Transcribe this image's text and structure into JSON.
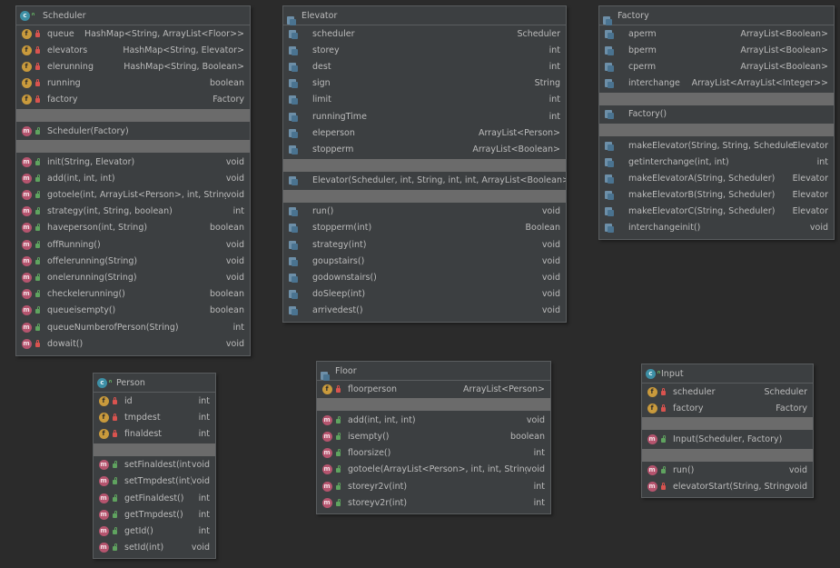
{
  "classes": {
    "scheduler": {
      "title": "Scheduler",
      "fields": [
        {
          "name": "queue",
          "type": "HashMap<String, ArrayList<Floor>>"
        },
        {
          "name": "elevators",
          "type": "HashMap<String, Elevator>"
        },
        {
          "name": "elerunning",
          "type": "HashMap<String, Boolean>"
        },
        {
          "name": "running",
          "type": "boolean"
        },
        {
          "name": "factory",
          "type": "Factory"
        }
      ],
      "constructors": [
        {
          "name": "Scheduler(Factory)"
        }
      ],
      "methods": [
        {
          "name": "init(String, Elevator)",
          "type": "void"
        },
        {
          "name": "add(int, int, int)",
          "type": "void"
        },
        {
          "name": "gotoele(int, ArrayList<Person>, int, String)",
          "type": "void"
        },
        {
          "name": "strategy(int, String, boolean)",
          "type": "int"
        },
        {
          "name": "haveperson(int, String)",
          "type": "boolean"
        },
        {
          "name": "offRunning()",
          "type": "void"
        },
        {
          "name": "offelerunning(String)",
          "type": "void"
        },
        {
          "name": "onelerunning(String)",
          "type": "void"
        },
        {
          "name": "checkelerunning()",
          "type": "boolean"
        },
        {
          "name": "queueisempty()",
          "type": "boolean"
        },
        {
          "name": "queueNumberofPerson(String)",
          "type": "int"
        },
        {
          "name": "dowait()",
          "type": "void"
        }
      ]
    },
    "elevator": {
      "title": "Elevator",
      "fields": [
        {
          "name": "scheduler",
          "type": "Scheduler"
        },
        {
          "name": "storey",
          "type": "int"
        },
        {
          "name": "dest",
          "type": "int"
        },
        {
          "name": "sign",
          "type": "String"
        },
        {
          "name": "limit",
          "type": "int"
        },
        {
          "name": "runningTime",
          "type": "int"
        },
        {
          "name": "eleperson",
          "type": "ArrayList<Person>"
        },
        {
          "name": "stopperm",
          "type": "ArrayList<Boolean>"
        }
      ],
      "constructors": [
        {
          "name": "Elevator(Scheduler, int, String, int, int, ArrayList<Boolean>)"
        }
      ],
      "methods": [
        {
          "name": "run()",
          "type": "void"
        },
        {
          "name": "stopperm(int)",
          "type": "Boolean"
        },
        {
          "name": "strategy(int)",
          "type": "void"
        },
        {
          "name": "goupstairs()",
          "type": "void"
        },
        {
          "name": "godownstairs()",
          "type": "void"
        },
        {
          "name": "doSleep(int)",
          "type": "void"
        },
        {
          "name": "arrivedest()",
          "type": "void"
        }
      ]
    },
    "factory": {
      "title": "Factory",
      "fields": [
        {
          "name": "aperm",
          "type": "ArrayList<Boolean>"
        },
        {
          "name": "bperm",
          "type": "ArrayList<Boolean>"
        },
        {
          "name": "cperm",
          "type": "ArrayList<Boolean>"
        },
        {
          "name": "interchange",
          "type": "ArrayList<ArrayList<Integer>>"
        }
      ],
      "constructors": [
        {
          "name": "Factory()"
        }
      ],
      "methods": [
        {
          "name": "makeElevator(String, String, Scheduler)",
          "type": "Elevator"
        },
        {
          "name": "getinterchange(int, int)",
          "type": "int"
        },
        {
          "name": "makeElevatorA(String, Scheduler)",
          "type": "Elevator"
        },
        {
          "name": "makeElevatorB(String, Scheduler)",
          "type": "Elevator"
        },
        {
          "name": "makeElevatorC(String, Scheduler)",
          "type": "Elevator"
        },
        {
          "name": "interchangeinit()",
          "type": "void"
        }
      ]
    },
    "person": {
      "title": "Person",
      "fields": [
        {
          "name": "id",
          "type": "int"
        },
        {
          "name": "tmpdest",
          "type": "int"
        },
        {
          "name": "finaldest",
          "type": "int"
        }
      ],
      "constructors": [],
      "methods": [
        {
          "name": "setFinaldest(int)",
          "type": "void"
        },
        {
          "name": "setTmpdest(int)",
          "type": "void"
        },
        {
          "name": "getFinaldest()",
          "type": "int"
        },
        {
          "name": "getTmpdest()",
          "type": "int"
        },
        {
          "name": "getId()",
          "type": "int"
        },
        {
          "name": "setId(int)",
          "type": "void"
        }
      ]
    },
    "floor": {
      "title": "Floor",
      "fields": [
        {
          "name": "floorperson",
          "type": "ArrayList<Person>"
        }
      ],
      "constructors": [],
      "methods": [
        {
          "name": "add(int, int, int)",
          "type": "void"
        },
        {
          "name": "isempty()",
          "type": "boolean"
        },
        {
          "name": "floorsize()",
          "type": "int"
        },
        {
          "name": "gotoele(ArrayList<Person>, int, int, String)",
          "type": "void"
        },
        {
          "name": "storeyr2v(int)",
          "type": "int"
        },
        {
          "name": "storeyv2r(int)",
          "type": "int"
        }
      ]
    },
    "input": {
      "title": "Input",
      "fields": [
        {
          "name": "scheduler",
          "type": "Scheduler"
        },
        {
          "name": "factory",
          "type": "Factory"
        }
      ],
      "constructors": [
        {
          "name": "Input(Scheduler, Factory)"
        }
      ],
      "methods": [
        {
          "name": "run()",
          "type": "void"
        },
        {
          "name": "elevatorStart(String, String)",
          "type": "void"
        }
      ]
    }
  }
}
